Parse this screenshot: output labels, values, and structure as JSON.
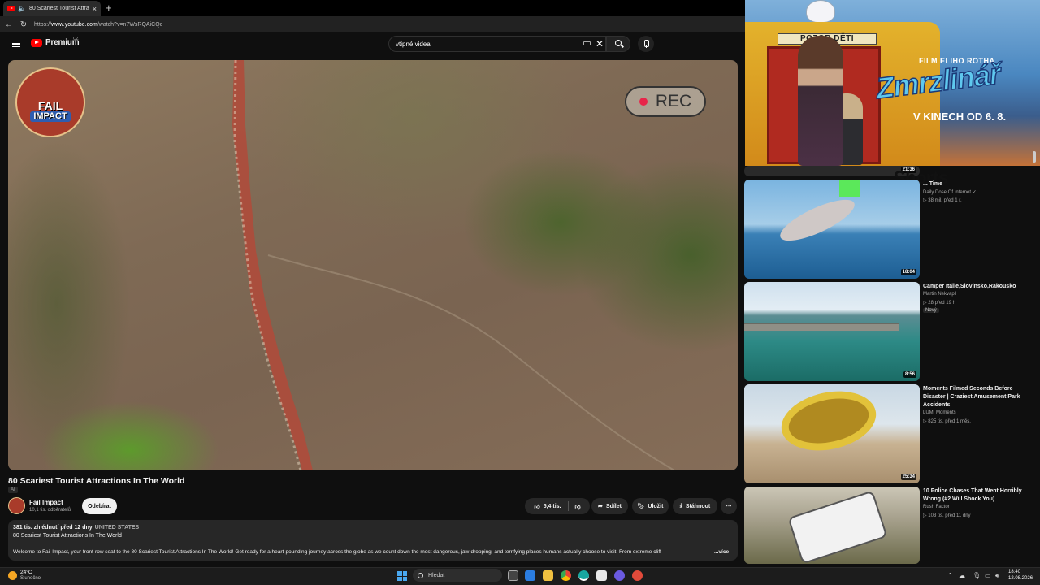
{
  "browser": {
    "tab_title": "80 Scariest Tourist Attractio...",
    "tab_close": "×",
    "new_tab": "+",
    "url_prefix": "https://",
    "url_domain": "www.youtube.com",
    "url_path": "/watch?v=n7WsRQAiCQc"
  },
  "youtube": {
    "logo_text": "Premium",
    "logo_region": "CZ",
    "search_value": "vtipné videa",
    "clear": "✕"
  },
  "video": {
    "rec_label": "REC",
    "channel_logo_line1": "FAIL",
    "channel_logo_line2": "IMPACT",
    "title": "80 Scariest Tourist Attractions In The World",
    "ai_badge": "AI",
    "channel": "Fail Impact",
    "subscribers": "10,1 tis. odběratelů",
    "subscribe_label": "Odebírat",
    "likes": "5,4 tis.",
    "share_label": "Sdílet",
    "save_label": "Uložit",
    "download_label": "Stáhnout",
    "more": "⋯",
    "description": {
      "meta": "381 tis. zhlédnutí  před 12 dny",
      "country": "UNITED STATES",
      "title_line": "80 Scariest Tourist Attractions In The World",
      "text": "Welcome to Fail Impact, your front-row seat to the 80 Scariest Tourist Attractions In The World! Get ready for a heart-pounding journey across the globe as we count down the most dangerous, jaw-dropping, and terrifying places humans actually choose to visit. From extreme cliff",
      "more_label": "...více"
    }
  },
  "ad": {
    "sign": "POZOR DĚTI",
    "film": "FILM ELIHO ROTHA",
    "brand": "Zmrzlinář",
    "date": "V KINECH OD 6. 8."
  },
  "sidebar": {
    "items": [
      {
        "duration": "21:36",
        "overlay": "Shorts",
        "title": "... Time",
        "channel": "Daily Dose Of Internet ✓",
        "meta": "▷ 38 mil.  před 1 r."
      },
      {
        "duration": "18:04",
        "title": "Camper Itálie,Slovinsko,Rakousko",
        "channel": "Martin Nekvapil",
        "meta": "▷ 28  před 19 h",
        "badge": "Nový"
      },
      {
        "duration": "8:56",
        "title": "Moments Filmed Seconds Before Disaster | Craziest Amusement Park Accidents",
        "channel": "LUMI Moments",
        "meta": "▷ 825 tis.  před 1 měs."
      },
      {
        "duration": "25:34",
        "title": "10 Police Chases That Went Horribly Wrong (#2 Will Shock You)",
        "channel": "Rush Factor",
        "meta": "▷ 103 tis.  před 11 dny"
      }
    ]
  },
  "taskbar": {
    "weather_temp": "24°C",
    "weather_desc": "Slunečno",
    "search_label": "Hledat",
    "time": "18:40",
    "date": "12.08.2026"
  },
  "colors": {
    "youtube_red": "#ff0000",
    "background": "#0f0f0f",
    "rec_dot": "#e8254a"
  }
}
